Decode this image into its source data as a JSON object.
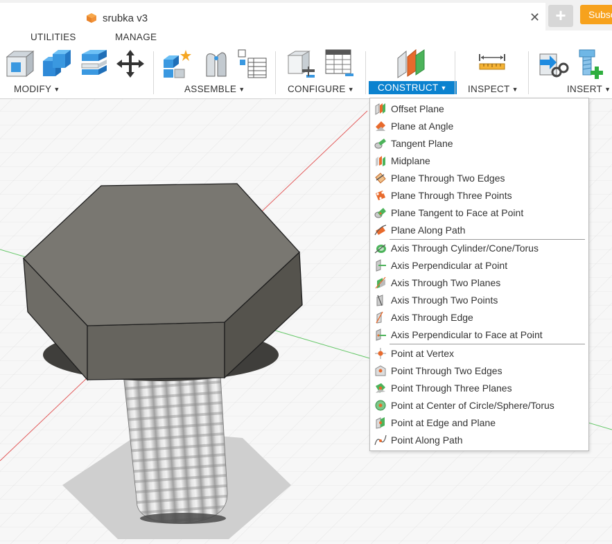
{
  "window": {
    "doc_title": "srubka v3",
    "subscribe_label": "Subsc",
    "close_glyph": "✕",
    "newtab_glyph": "+"
  },
  "toolbar": {
    "tabs": [
      "UTILITIES",
      "MANAGE"
    ],
    "groups": {
      "modify": "MODIFY",
      "assemble": "ASSEMBLE",
      "configure": "CONFIGURE",
      "construct": "CONSTRUCT",
      "inspect": "INSPECT",
      "insert": "INSERT"
    },
    "caret": "▼"
  },
  "menu": {
    "planes": [
      "Offset Plane",
      "Plane at Angle",
      "Tangent Plane",
      "Midplane",
      "Plane Through Two Edges",
      "Plane Through Three Points",
      "Plane Tangent to Face at Point",
      "Plane Along Path"
    ],
    "axes": [
      "Axis Through Cylinder/Cone/Torus",
      "Axis Perpendicular at Point",
      "Axis Through Two Planes",
      "Axis Through Two Points",
      "Axis Through Edge",
      "Axis Perpendicular to Face at Point"
    ],
    "points": [
      "Point at Vertex",
      "Point Through Two Edges",
      "Point Through Three Planes",
      "Point at Center of Circle/Sphere/Torus",
      "Point at Edge and Plane",
      "Point Along Path"
    ]
  },
  "colors": {
    "accent": "#0b82cf",
    "subscribe": "#f7a21d",
    "bolt_top": "#79766e",
    "bolt_side": "#5c5a54",
    "axis_red": "#e25b5b",
    "axis_green": "#67c86a"
  }
}
